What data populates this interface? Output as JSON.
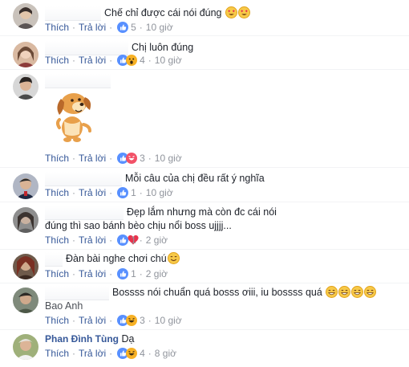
{
  "actions": {
    "like": "Thích",
    "reply": "Trả lời",
    "separator": "·"
  },
  "comments": [
    {
      "author": "",
      "text": "Chế chỉ được cái nói đúng",
      "reactions": "5",
      "time": "10 giờ"
    },
    {
      "author": "",
      "text": "Chị luôn đúng",
      "reactions": "4",
      "time": "10 giờ"
    },
    {
      "author": "",
      "text": "",
      "reactions": "3",
      "time": "10 giờ"
    },
    {
      "author": "",
      "text": "Mỗi câu của chị đều rất ý nghĩa",
      "reactions": "1",
      "time": "10 giờ"
    },
    {
      "author": "",
      "text": "Đẹp lắm nhưng mà còn đc cái nói đúng thì sao bánh bèo chịu nổi boss ujjjj...",
      "reactions": "1",
      "time": "2 giờ"
    },
    {
      "author": "",
      "text": "Đàn bài nghe chơi chú",
      "reactions": "1",
      "time": "2 giờ"
    },
    {
      "author": "Bao Anh",
      "text": "Bossss nói chuẩn quá bosss ơiii, iu bossss quá",
      "reactions": "3",
      "time": "10 giờ"
    },
    {
      "author": "Phan Đình Tùng",
      "text": "Dạ",
      "reactions": "4",
      "time": "8 giờ"
    }
  ],
  "colors": {
    "link": "#365899",
    "meta": "#90949c",
    "like": "#5890ff",
    "love": "#f25268",
    "haha": "#f7b125"
  }
}
